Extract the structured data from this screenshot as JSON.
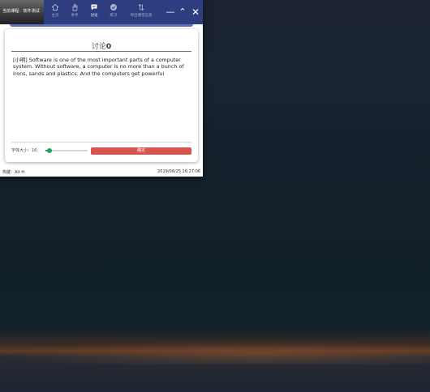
{
  "app": {
    "course_label": "当前课程：软件测试",
    "nav": [
      {
        "label": "主页",
        "icon": "home-icon"
      },
      {
        "label": "举手",
        "icon": "raise-hand-icon"
      },
      {
        "label": "讨论",
        "icon": "discussion-icon"
      },
      {
        "label": "练习",
        "icon": "exercise-check-icon"
      },
      {
        "label": "导出课堂信息",
        "icon": "export-sort-icon"
      }
    ],
    "active_nav": "讨论",
    "window_buttons": {
      "minimize": "—",
      "maximize": "⌃",
      "close": "✕"
    },
    "accent_color": "#2e3d7f"
  },
  "discussion": {
    "title": "讨论",
    "count": "0",
    "message": "[小明] Software is one of the most important parts of a computer system. Without software, a computer is no more than a bunch of irons, sands and plastics. And the computers get powerful",
    "font_size_label": "字体大小：16",
    "font_size_level": 0.1,
    "confirm_label": "确定",
    "confirm_color": "#d9534f"
  },
  "status": {
    "hint": "热键：Alt H",
    "timestamp": "2019/06/25 16:27:06"
  }
}
